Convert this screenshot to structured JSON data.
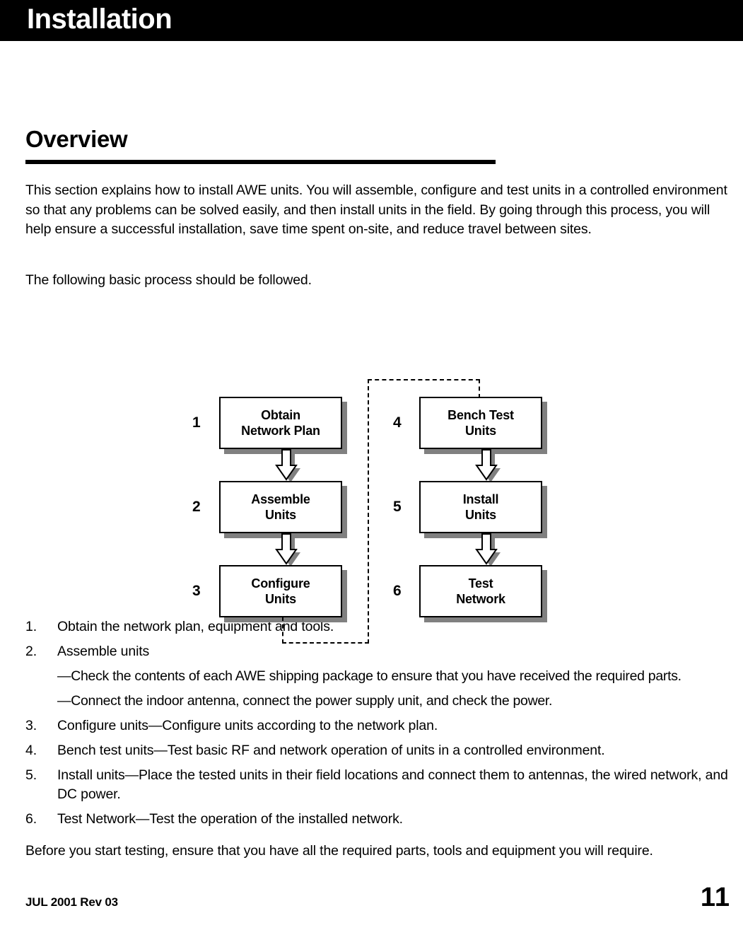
{
  "header": {
    "title": "Installation"
  },
  "section": {
    "heading": "Overview",
    "intro": "This section explains how to install AWE units. You will assemble, configure and test units in a controlled environment so that any problems can be solved easily, and then install units in the field. By going through this process, you will help ensure a successful installation, save time spent on-site, and reduce travel between sites.",
    "follow": "The following basic process should be followed."
  },
  "flowchart": {
    "left_column": [
      {
        "number": "1",
        "label_line1": "Obtain",
        "label_line2": "Network Plan"
      },
      {
        "number": "2",
        "label_line1": "Assemble",
        "label_line2": "Units"
      },
      {
        "number": "3",
        "label_line1": "Configure",
        "label_line2": "Units"
      }
    ],
    "right_column": [
      {
        "number": "4",
        "label_line1": "Bench Test",
        "label_line2": "Units"
      },
      {
        "number": "5",
        "label_line1": "Install",
        "label_line2": "Units"
      },
      {
        "number": "6",
        "label_line1": "Test",
        "label_line2": "Network"
      }
    ],
    "colors": {
      "box_fill": "#ffffff",
      "box_border": "#000000",
      "shadow": "#808080",
      "arrow_fill": "#ffffff",
      "arrow_outline": "#000000"
    }
  },
  "steps": [
    {
      "marker": "1.",
      "text": "Obtain the network plan, equipment and tools."
    },
    {
      "marker": "2.",
      "text": "Assemble units"
    },
    {
      "marker": "3.",
      "text": "Configure units—Configure units according to the network plan."
    },
    {
      "marker": "4.",
      "text": "Bench test units—Test basic RF and network operation of units in a controlled environment."
    },
    {
      "marker": "5.",
      "text": "Install units—Place the tested units in their field locations and connect them to antennas, the wired network, and DC power."
    },
    {
      "marker": "6.",
      "text": "Test Network—Test the operation of the installed network."
    }
  ],
  "substeps": [
    "—Check the contents of each AWE shipping package to ensure that you have received the required parts.",
    "—Connect the indoor antenna, connect the power supply unit, and check the power."
  ],
  "closing": "Before you start testing, ensure that you have all the required parts, tools and equipment you will require.",
  "footer": {
    "revision": "JUL 2001 Rev 03",
    "page_number": "11"
  }
}
